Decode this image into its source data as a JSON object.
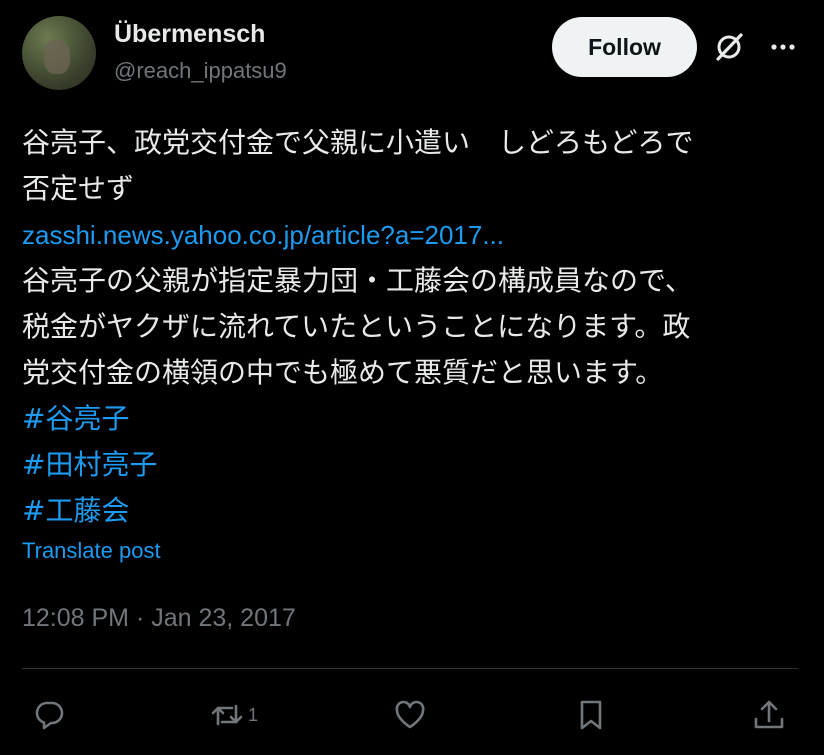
{
  "author": {
    "name": "Übermensch",
    "handle": "@reach_ippatsu9"
  },
  "header": {
    "follow_label": "Follow"
  },
  "post": {
    "line1": "谷亮子、政党交付金で父親に小遣い　しどろもどろで",
    "line2": "否定せず",
    "link": "zasshi.news.yahoo.co.jp/article?a=2017...",
    "line3": "谷亮子の父親が指定暴力団・工藤会の構成員なので、",
    "line4": "税金がヤクザに流れていたということになります。政",
    "line5": "党交付金の横領の中でも極めて悪質だと思います。",
    "hashtags": [
      "#谷亮子",
      "#田村亮子",
      "#工藤会"
    ],
    "translate_label": "Translate post",
    "timestamp": "12:08 PM · Jan 23, 2017"
  },
  "actions": {
    "reply_count": "",
    "repost_count": "1",
    "like_count": "",
    "icons": [
      "reply-icon",
      "repost-icon",
      "like-icon",
      "bookmark-icon",
      "share-icon"
    ]
  },
  "colors": {
    "background": "#000000",
    "text": "#e7e9ea",
    "muted": "#71767b",
    "accent": "#1d9bf0",
    "button_bg": "#eff3f4"
  }
}
